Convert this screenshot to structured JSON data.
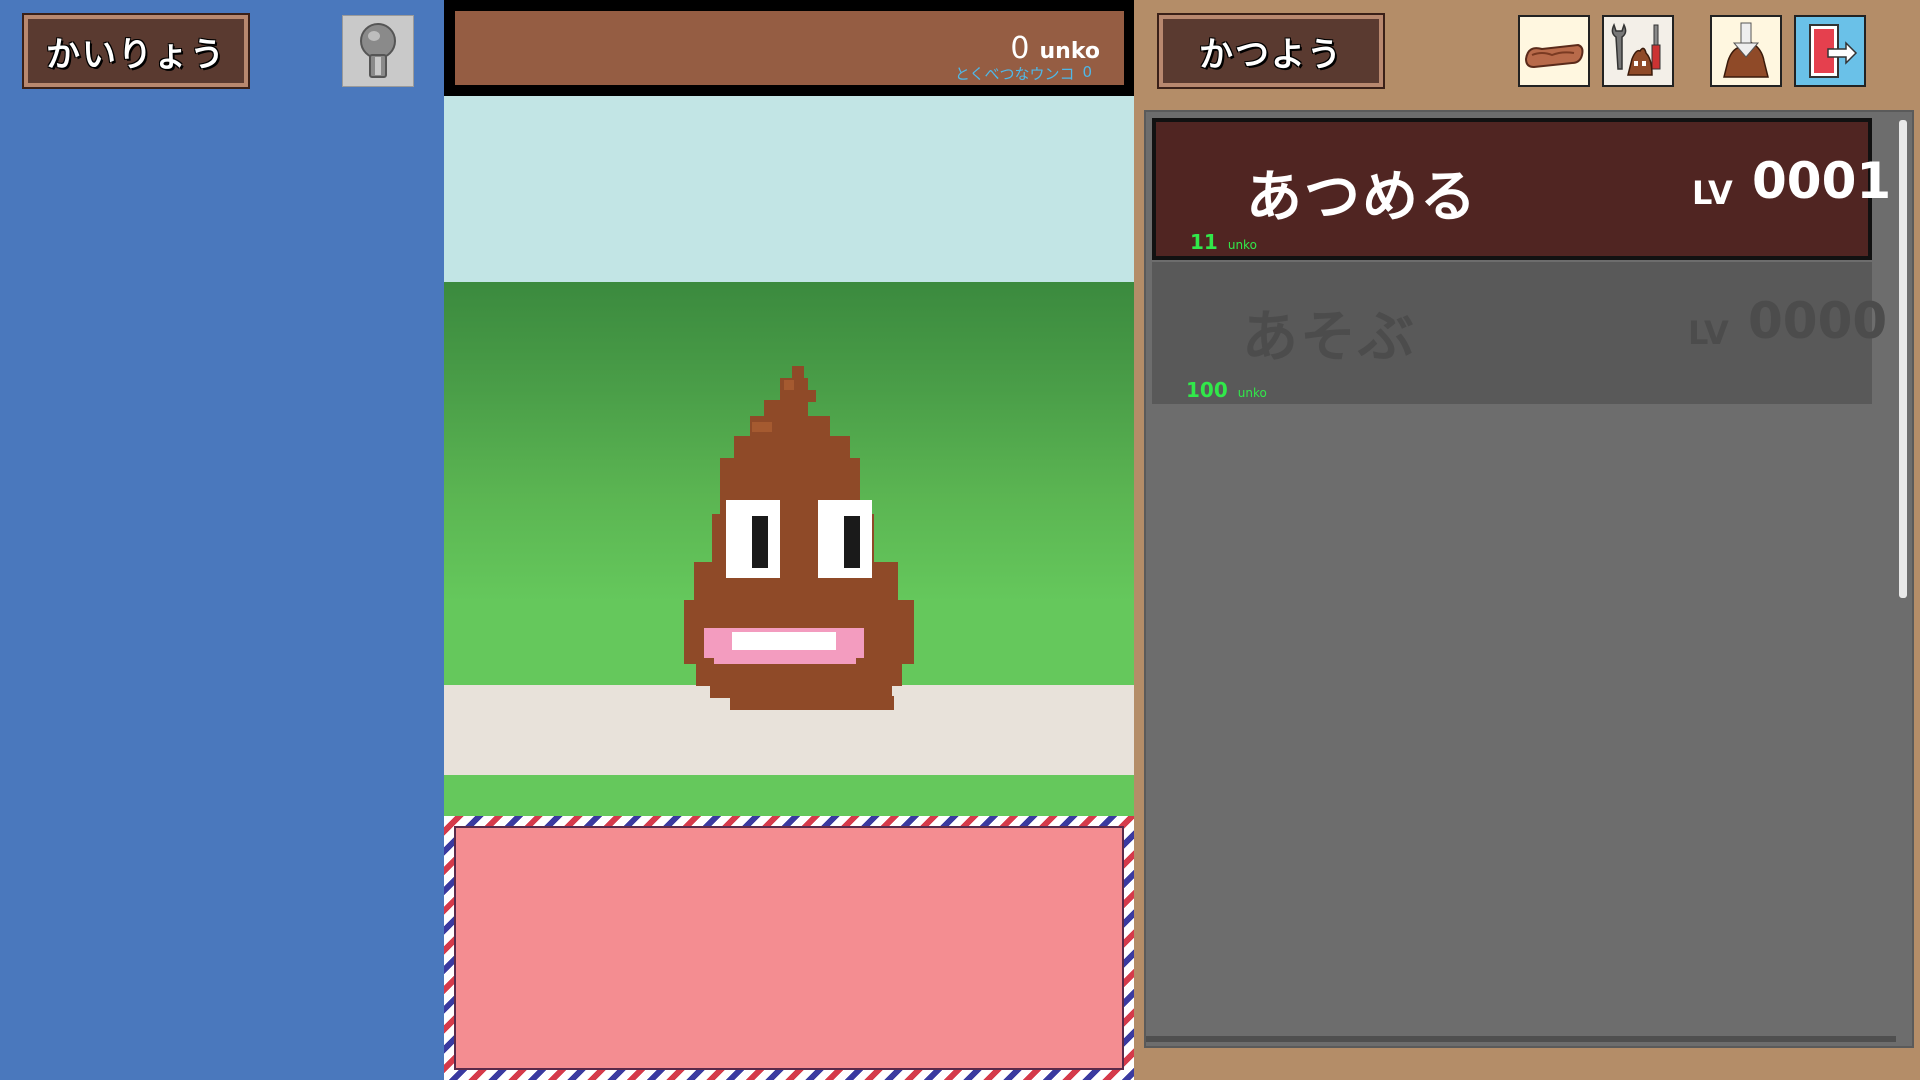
{
  "left_panel": {
    "tab_label": "かいりょう",
    "pin_icon": "pin-icon"
  },
  "counter": {
    "value": "0",
    "unit": "unko",
    "special_label": "とくべつなウンコ",
    "special_value": "0"
  },
  "right_panel": {
    "tab_label": "かつよう",
    "icons": [
      "scroll-icon",
      "tools-icon",
      "drop-icon",
      "exit-icon"
    ]
  },
  "upgrades": [
    {
      "title": "あつめる",
      "lv_label": "LV",
      "lv_value": "0001",
      "cost": "11",
      "cost_unit": "unko"
    },
    {
      "title": "あそぶ",
      "lv_label": "LV",
      "lv_value": "0000",
      "cost": "100",
      "cost_unit": "unko"
    }
  ],
  "colors": {
    "left_bg": "#4a78bd",
    "right_bg": "#b48d68",
    "counter_bg": "#955d43",
    "character": "#8f4a28",
    "message_box": "#f48d91",
    "cost_text": "#31e84a"
  }
}
